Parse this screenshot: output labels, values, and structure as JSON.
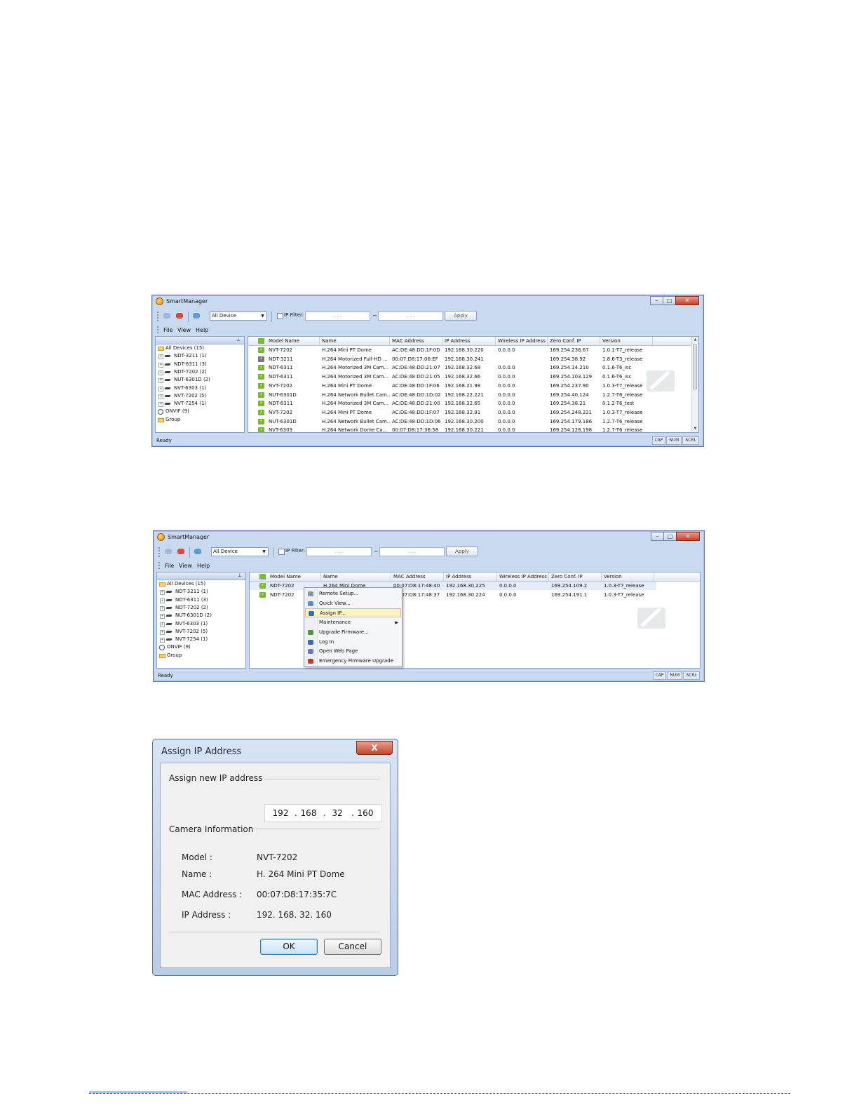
{
  "window1": {
    "title": "SmartManager",
    "device_filter": "All Device",
    "ip_filter_label": "IP Filter:",
    "ip_placeholder": ".   .   .",
    "apply": "Apply",
    "menu": [
      "File",
      "View",
      "Help"
    ],
    "tree": [
      {
        "label": "All Devices (15)",
        "type": "folder"
      },
      {
        "label": "NDT-3211 (1)",
        "type": "cam"
      },
      {
        "label": "NDT-6311 (3)",
        "type": "cam"
      },
      {
        "label": "NDT-7202 (2)",
        "type": "cam"
      },
      {
        "label": "NUT-6301D (2)",
        "type": "cam"
      },
      {
        "label": "NVT-6303 (1)",
        "type": "cam"
      },
      {
        "label": "NVT-7202 (5)",
        "type": "cam"
      },
      {
        "label": "NVT-7254 (1)",
        "type": "cam"
      },
      {
        "label": "ONVIF (9)",
        "type": "ring"
      },
      {
        "label": "Group",
        "type": "folder"
      }
    ],
    "columns": [
      "Model Name",
      "Name",
      "MAC Address",
      "IP Address",
      "Wireless IP Address",
      "Zero Conf. IP",
      "Version"
    ],
    "rows": [
      [
        "NVT-7202",
        "H.264 Mini PT Dome",
        "AC:DE:48:DD:1F:0D",
        "192.168.30.220",
        "0.0.0.0",
        "169.254.236.67",
        "1.0.1-T7_release"
      ],
      [
        "NDT-3211",
        "H.264 Motorized Full-HD ...",
        "00:07:D8:17:06:EF",
        "192.168.30.241",
        "",
        "169.254.38.92",
        "1.8.6-T3_release"
      ],
      [
        "NDT-6311",
        "H.264 Motorized 3M Cam...",
        "AC:DE:48:DD:21:07",
        "192.168.32.68",
        "0.0.0.0",
        "169.254.14.210",
        "0.1.6-T6_isc"
      ],
      [
        "NDT-6311",
        "H.264 Motorized 3M Cam...",
        "AC:DE:48:DD:21:05",
        "192.168.32.66",
        "0.0.0.0",
        "169.254.103.129",
        "0.1.6-T6_isc"
      ],
      [
        "NVT-7202",
        "H.264 Mini PT Dome",
        "AC:DE:48:DD:1F:06",
        "192.168.21.98",
        "0.0.0.0",
        "169.254.237.90",
        "1.0.3-T7_release"
      ],
      [
        "NUT-6301D",
        "H.264 Network Bullet Cam...",
        "AC:DE:48:DD:1D:02",
        "192.168.22.221",
        "0.0.0.0",
        "169.254.40.124",
        "1.2.7-T6_release"
      ],
      [
        "NDT-6311",
        "H.264 Motorized 3M Cam...",
        "AC:DE:48:DD:21:00",
        "192.168.32.65",
        "0.0.0.0",
        "169.254.38.21",
        "0.1.2-T6_test"
      ],
      [
        "NVT-7202",
        "H.264 Mini PT Dome",
        "AC:DE:48:DD:1F:07",
        "192.168.32.91",
        "0.0.0.0",
        "169.254.248.221",
        "1.0.3-T7_release"
      ],
      [
        "NUT-6301D",
        "H.264 Network Bullet Cam...",
        "AC:DE:48:DD:1D:06",
        "192.168.30.200",
        "0.0.0.0",
        "169.254.179.186",
        "1.2.7-T6_release"
      ],
      [
        "NVT-6303",
        "H.264 Network Dome Ca...",
        "00:07:D8:17:36:58",
        "192.168.30.221",
        "0.0.0.0",
        "169.254.128.198",
        "1.2.7-T6_release"
      ]
    ],
    "status": "Ready",
    "status_cells": [
      "CAP",
      "NUM",
      "SCRL"
    ]
  },
  "window2": {
    "title": "SmartManager",
    "device_filter": "All Device",
    "ip_filter_label": "IP Filter:",
    "ip_placeholder": ".   .   .",
    "apply": "Apply",
    "menu": [
      "File",
      "View",
      "Help"
    ],
    "tree": [
      {
        "label": "All Devices (15)",
        "type": "folder"
      },
      {
        "label": "NDT-3211 (1)",
        "type": "cam"
      },
      {
        "label": "NDT-6311 (3)",
        "type": "cam"
      },
      {
        "label": "NDT-7202 (2)",
        "type": "cam"
      },
      {
        "label": "NUT-6301D (2)",
        "type": "cam"
      },
      {
        "label": "NVT-6303 (1)",
        "type": "cam"
      },
      {
        "label": "NVT-7202 (5)",
        "type": "cam"
      },
      {
        "label": "NVT-7254 (1)",
        "type": "cam"
      },
      {
        "label": "ONVIF (9)",
        "type": "ring"
      },
      {
        "label": "Group",
        "type": "folder"
      }
    ],
    "columns": [
      "Model Name",
      "Name",
      "MAC Address",
      "IP Address",
      "Wireless IP Address",
      "Zero Conf. IP",
      "Version"
    ],
    "rows": [
      [
        "NDT-7202",
        "H.264 Mini Dome",
        "00:07:D8:17:48:40",
        "192.168.30.225",
        "0.0.0.0",
        "169.254.109.2",
        "1.0.3-T7_release"
      ],
      [
        "NDT-7202",
        "",
        "00:07:D8:17:48:37",
        "192.168.30.224",
        "0.0.0.0",
        "169.254.191.1",
        "1.0.3-T7_release"
      ]
    ],
    "context_menu": [
      {
        "label": "Remote Setup...",
        "icon": "gear-icon",
        "color": "#8a94a4"
      },
      {
        "label": "Quick View...",
        "icon": "eye-icon",
        "color": "#5a8fc8"
      },
      {
        "label": "Assign IP...",
        "icon": "globe-icon",
        "color": "#2d6fb4",
        "highlight": true
      },
      {
        "label": "Maintenance",
        "icon": "",
        "color": "",
        "submenu": true
      },
      {
        "label": "Upgrade Firmware...",
        "icon": "upgrade-icon",
        "color": "#4a9a3a"
      },
      {
        "label": "Log In",
        "icon": "user-icon",
        "color": "#3a6aa8"
      },
      {
        "label": "Open Web Page",
        "icon": "web-icon",
        "color": "#6a7ab8"
      },
      {
        "label": "Emergency Firmware Upgrade",
        "icon": "emergency-icon",
        "color": "#c83a2a"
      }
    ],
    "status": "Ready",
    "status_cells": [
      "CAP",
      "NUM",
      "SCRL"
    ]
  },
  "dialog": {
    "title": "Assign IP Address",
    "close": "X",
    "assign_section": "Assign new IP address",
    "ip": [
      "192",
      "168",
      "32",
      "160"
    ],
    "camera_section": "Camera Information",
    "info": [
      {
        "label": "Model :",
        "value": "NVT-7202"
      },
      {
        "label": "Name :",
        "value": "H. 264 Mini PT Dome"
      },
      {
        "label": "MAC Address :",
        "value": "00:07:D8:17:35:7C"
      },
      {
        "label": "IP Address :",
        "value": "192. 168. 32. 160"
      }
    ],
    "ok": "OK",
    "cancel": "Cancel"
  }
}
